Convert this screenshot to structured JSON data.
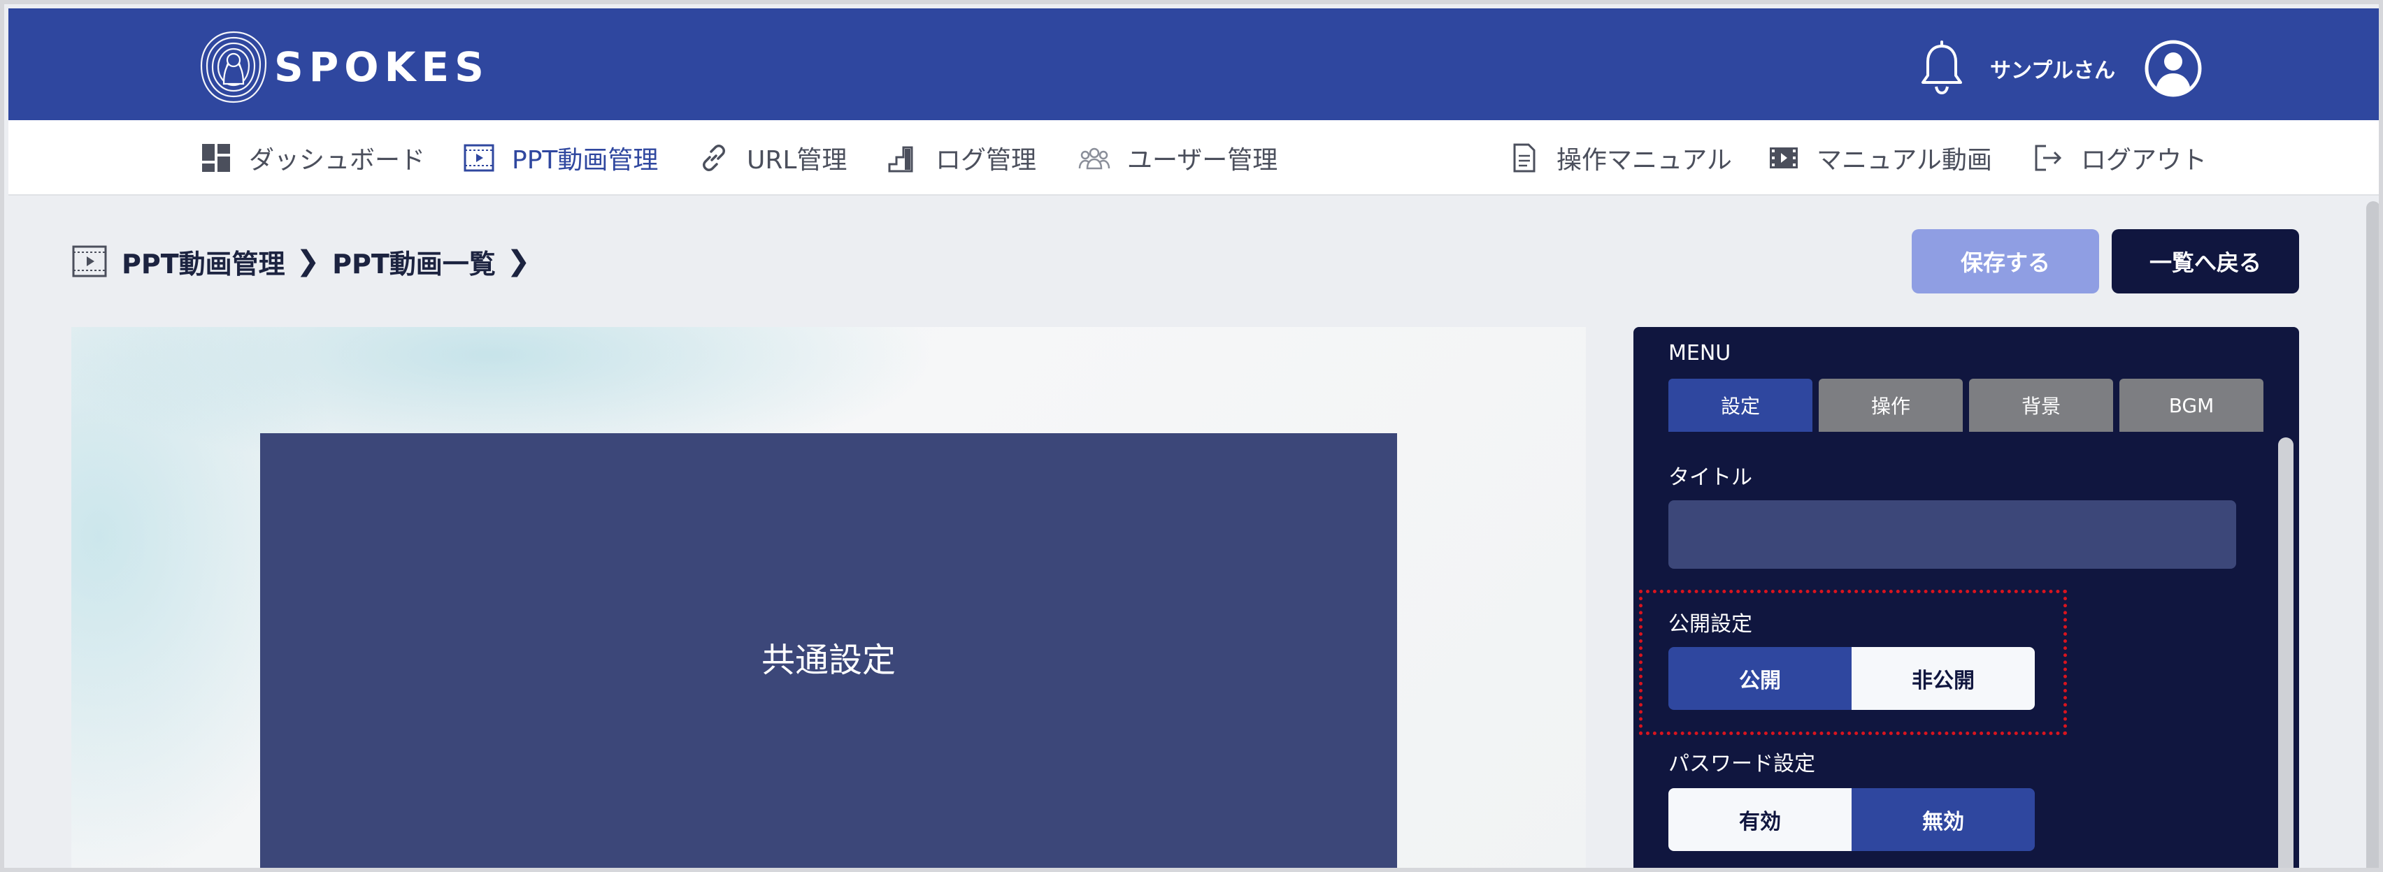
{
  "app": {
    "logo_text": "SPOKES",
    "user_name": "サンプルさん",
    "brand_color": "#2f479f",
    "dark_color": "#10163f"
  },
  "nav": {
    "left_items": [
      {
        "label": "ダッシュボード",
        "icon": "dashboard-icon"
      },
      {
        "label": "PPT動画管理",
        "icon": "video-frame-icon",
        "active": true
      },
      {
        "label": "URL管理",
        "icon": "link-icon"
      },
      {
        "label": "ログ管理",
        "icon": "log-chart-icon"
      },
      {
        "label": "ユーザー管理",
        "icon": "users-icon"
      }
    ],
    "right_items": [
      {
        "label": "操作マニュアル",
        "icon": "document-icon"
      },
      {
        "label": "マニュアル動画",
        "icon": "film-icon"
      },
      {
        "label": "ログアウト",
        "icon": "logout-icon"
      }
    ]
  },
  "breadcrumb": {
    "items": [
      "PPT動画管理",
      "PPT動画一覧"
    ]
  },
  "actions": {
    "save_label": "保存する",
    "back_label": "一覧へ戻る"
  },
  "preview": {
    "slide_title": "共通設定"
  },
  "panel": {
    "menu_label": "MENU",
    "tabs": [
      {
        "label": "設定",
        "active": true
      },
      {
        "label": "操作"
      },
      {
        "label": "背景"
      },
      {
        "label": "BGM"
      }
    ],
    "title_label": "タイトル",
    "title_value": "",
    "publish": {
      "label": "公開設定",
      "options": [
        "公開",
        "非公開"
      ],
      "selected": "公開"
    },
    "password": {
      "label": "パスワード設定",
      "options": [
        "有効",
        "無効"
      ],
      "selected": "無効"
    },
    "highlight_color": "#d9141e"
  }
}
